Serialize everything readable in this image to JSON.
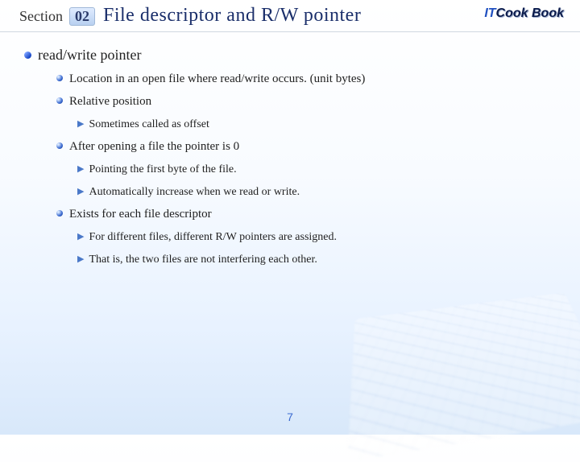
{
  "header": {
    "section_label": "Section",
    "section_num": "02",
    "title": "File descriptor and R/W pointer"
  },
  "logo": {
    "it": "IT",
    "cookbook": "Cook Book"
  },
  "heading": "read/write pointer",
  "items": [
    {
      "text": "Location in an open file where read/write occurs. (unit bytes)",
      "sub": []
    },
    {
      "text": "Relative position",
      "sub": [
        "Sometimes called as offset"
      ]
    },
    {
      "text": "After opening a file the pointer is 0",
      "sub": [
        "Pointing the first byte of the file.",
        "Automatically increase when we read or write."
      ]
    },
    {
      "text": "Exists for each file descriptor",
      "sub": [
        "For different files, different R/W pointers are assigned.",
        "That is, the two files are not interfering each other."
      ]
    }
  ],
  "page_number": "7"
}
